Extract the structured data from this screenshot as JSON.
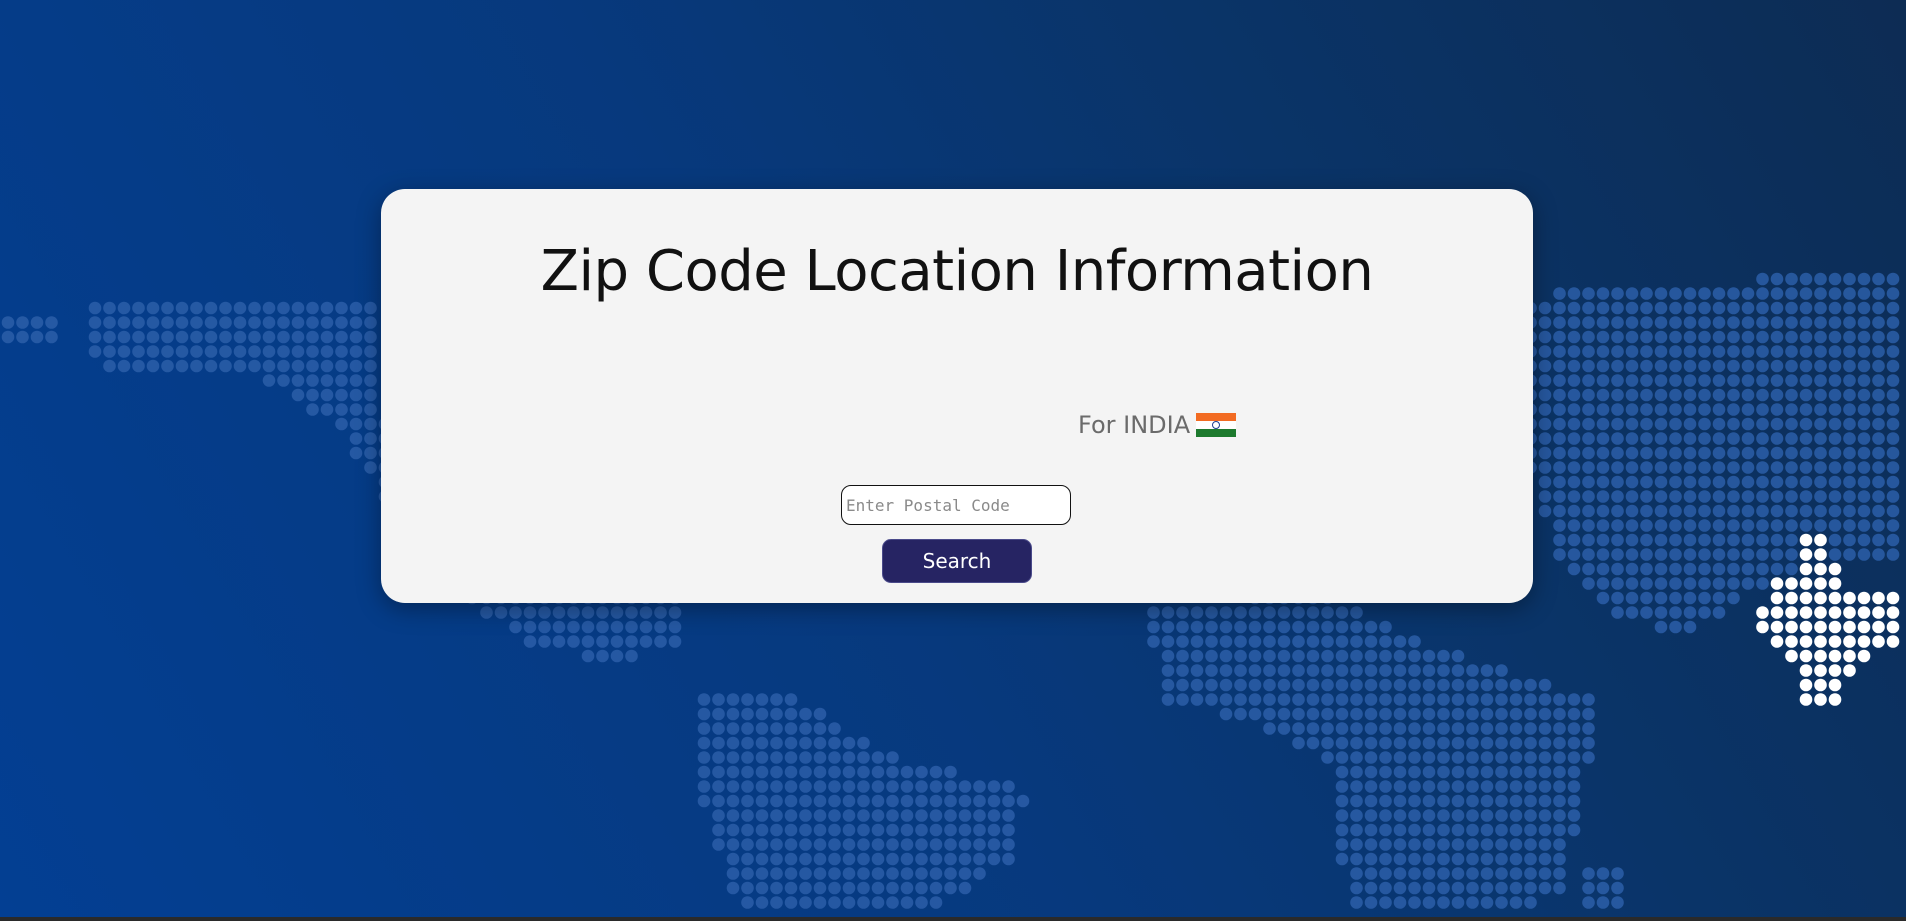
{
  "page": {
    "title": "Zip Code Location Information",
    "country_label": "For INDIA",
    "country_flag_icon": "india-flag-icon"
  },
  "search": {
    "placeholder": "Enter Postal Code",
    "value": "",
    "button_label": "Search"
  },
  "colors": {
    "card_background": "#f4f4f4",
    "button_background": "#262463",
    "map_dots": "#2c5ea8",
    "highlight_dots": "#ffffff"
  }
}
